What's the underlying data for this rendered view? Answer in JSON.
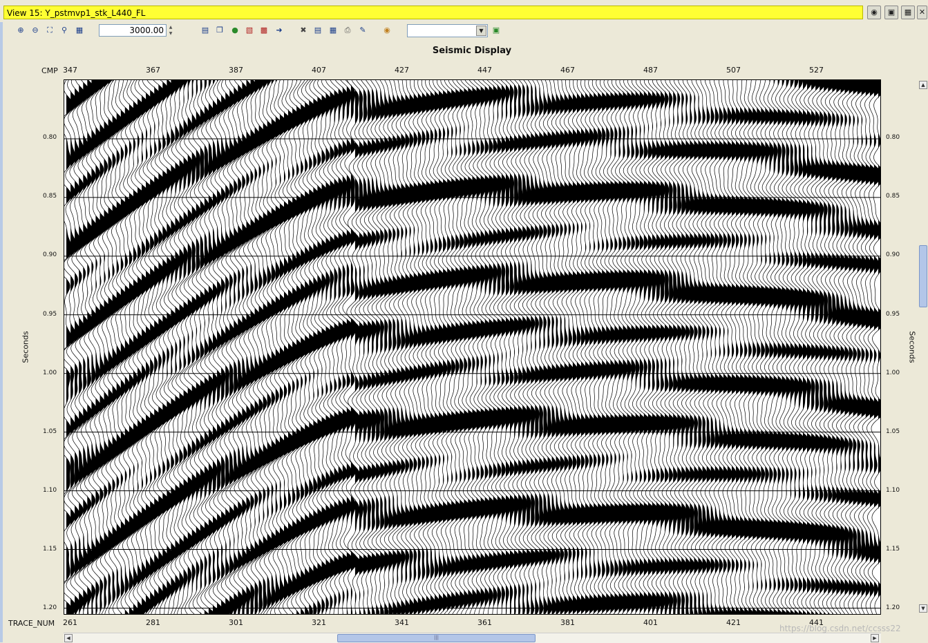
{
  "window": {
    "title": "View 15: Y_pstmvp1_stk_L440_FL",
    "right_buttons": [
      "lock-icon",
      "photo-icon",
      "grid-icon",
      "close-icon"
    ]
  },
  "toolbar": {
    "zoom_value": "3000.00",
    "view_select_value": "",
    "icons": [
      "zoom-in-icon",
      "zoom-out-icon",
      "zoom-fit-icon",
      "zoom-icon",
      "grid-view-icon",
      "clipboard-icon",
      "copy-icon",
      "cylinder-icon",
      "traces-icon",
      "color-bar-icon",
      "export-icon",
      "tools-icon",
      "list-icon",
      "table-icon",
      "print-icon",
      "edit-icon",
      "palette-icon",
      "refresh-icon"
    ]
  },
  "plot": {
    "title": "Seismic Display",
    "top_axis_name": "CMP",
    "bottom_axis_name": "TRACE_NUM",
    "left_axis_name": "Seconds",
    "right_axis_name": "Seconds"
  },
  "chart_data": {
    "type": "wiggle",
    "top_axis": {
      "name": "CMP",
      "ticks": [
        "347",
        "367",
        "387",
        "407",
        "427",
        "447",
        "467",
        "487",
        "507",
        "527"
      ]
    },
    "bottom_axis": {
      "name": "TRACE_NUM",
      "ticks": [
        "261",
        "281",
        "301",
        "321",
        "341",
        "361",
        "381",
        "401",
        "421",
        "441"
      ]
    },
    "y_axis": {
      "name": "Seconds",
      "ticks": [
        "0.80",
        "0.85",
        "0.90",
        "0.95",
        "1.00",
        "1.05",
        "1.10",
        "1.15",
        "1.20"
      ],
      "range": [
        0.75,
        1.205
      ]
    },
    "grid": true
  },
  "footer": {
    "watermark": "https://blog.csdn.net/ccsss22"
  }
}
